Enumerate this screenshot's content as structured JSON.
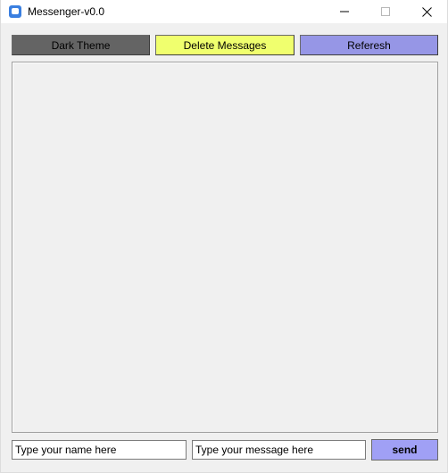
{
  "window": {
    "title": "Messenger-v0.0"
  },
  "toolbar": {
    "dark_theme_label": "Dark Theme",
    "delete_messages_label": "Delete Messages",
    "refresh_label": "Referesh"
  },
  "composer": {
    "name_placeholder": "Type your name here",
    "message_placeholder": "Type your message here",
    "send_label": "send"
  },
  "colors": {
    "dark_theme_button": "#646464",
    "delete_button": "#f0ff6e",
    "refresh_button": "#9696e6",
    "send_button": "#a0a0f5"
  }
}
